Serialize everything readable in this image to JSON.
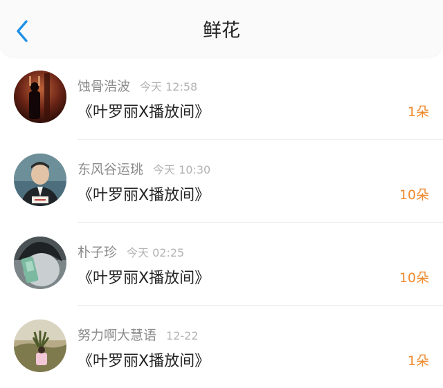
{
  "header": {
    "title": "鲜花",
    "back_icon": "chevron-left-icon"
  },
  "colors": {
    "accent": "#1e90e6",
    "count": "#f08a2e"
  },
  "items": [
    {
      "user": "蚀骨浩波",
      "time": "今天 12:58",
      "work": "《叶罗丽X播放间》",
      "count": "1朵"
    },
    {
      "user": "东风谷运珧",
      "time": "今天 10:30",
      "work": "《叶罗丽X播放间》",
      "count": "10朵"
    },
    {
      "user": "朴子珍",
      "time": "今天 02:25",
      "work": "《叶罗丽X播放间》",
      "count": "10朵"
    },
    {
      "user": "努力啊大慧语",
      "time": "12-22",
      "work": "《叶罗丽X播放间》",
      "count": "1朵"
    }
  ]
}
